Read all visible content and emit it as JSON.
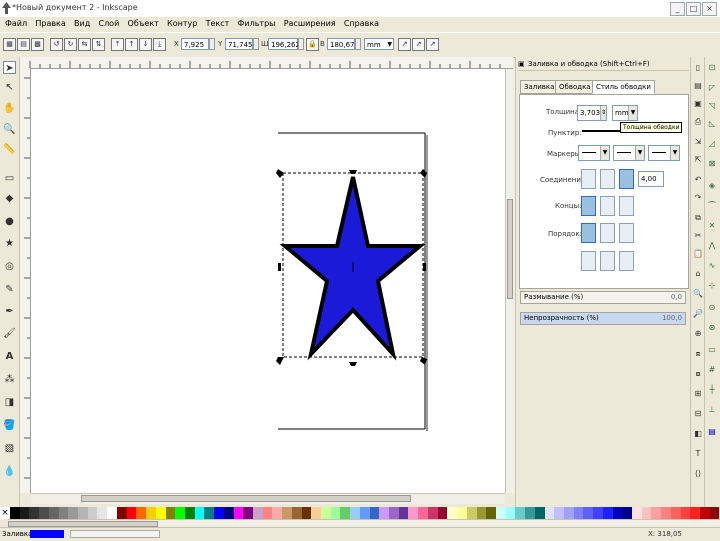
{
  "window": {
    "title": "*Новый документ 2 - Inkscape",
    "minimize": "_",
    "maximize": "□",
    "close": "×"
  },
  "menu": [
    "Файл",
    "Правка",
    "Вид",
    "Слой",
    "Объект",
    "Контур",
    "Текст",
    "Фильтры",
    "Расширения",
    "Справка"
  ],
  "toolbar": {
    "x_label": "X",
    "x_value": "7,925",
    "y_label": "Y",
    "y_value": "71,745",
    "w_label": "Ш",
    "w_value": "196,262",
    "h_label": "В",
    "h_value": "180,671",
    "unit": "mm"
  },
  "panel": {
    "title": "Заливка и обводка (Shift+Ctrl+F)",
    "tabs": [
      "Заливка",
      "Обводка",
      "Стиль обводки"
    ],
    "width_label": "Толщина:",
    "width_value": "3,703",
    "width_unit": "mm",
    "tooltip": "Толщина обводки",
    "dash_label": "Пунктир:",
    "markers_label": "Маркеры:",
    "join_label": "Соединение:",
    "miter_value": "4,00",
    "cap_label": "Концы:",
    "order_label": "Порядок:",
    "blur_label": "Размывание (%)",
    "blur_value": "0,0",
    "opacity_label": "Непрозрачность (%)",
    "opacity_value": "100,0"
  },
  "star": {
    "fill": "#1a1ad8",
    "stroke": "#000000"
  },
  "status": {
    "fill_label": "Заливка:",
    "fill_color": "#0000ff",
    "coords": "X: 318,05"
  },
  "palette": [
    "#000000",
    "#1a1a1a",
    "#333333",
    "#4d4d4d",
    "#666666",
    "#808080",
    "#999999",
    "#b3b3b3",
    "#cccccc",
    "#e6e6e6",
    "#ffffff",
    "#800000",
    "#ff0000",
    "#ff6600",
    "#ffcc00",
    "#ffff00",
    "#808000",
    "#00ff00",
    "#008000",
    "#00ffff",
    "#008080",
    "#0000ff",
    "#000080",
    "#ff00ff",
    "#800080",
    "#c8a0c8",
    "#ff8080",
    "#ffaaaa",
    "#cc9966",
    "#996633",
    "#663300",
    "#ffcc99",
    "#ccff99",
    "#99ff99",
    "#66cc66",
    "#99ccff",
    "#6699ff",
    "#3366cc",
    "#cc99ff",
    "#9966cc",
    "#663399",
    "#ff99cc",
    "#ff6699",
    "#cc3366",
    "#990033",
    "#ffffcc",
    "#ffff99",
    "#cccc66",
    "#999933",
    "#666600",
    "#ccffff",
    "#99ffff",
    "#66cccc",
    "#339999",
    "#006666",
    "#e0e0ff",
    "#c0c0ff",
    "#a0a0ff",
    "#8080ff",
    "#6060ff",
    "#4040ff",
    "#2020ff",
    "#0000c0",
    "#000090",
    "#ffe0e0",
    "#ffc0c0",
    "#ffa0a0",
    "#ff8080",
    "#ff6060",
    "#ff4040",
    "#ff2020",
    "#c00000",
    "#900000"
  ]
}
